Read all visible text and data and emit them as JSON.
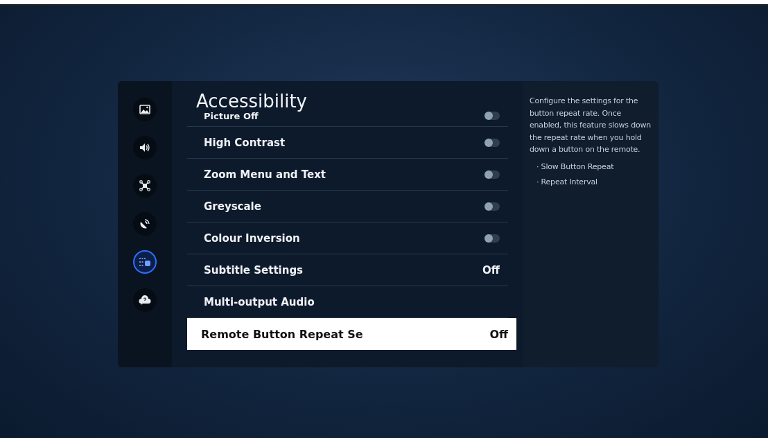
{
  "sidebar": {
    "items": [
      {
        "kind": "picture",
        "selected": false
      },
      {
        "kind": "sound",
        "selected": false
      },
      {
        "kind": "connection",
        "selected": false
      },
      {
        "kind": "broadcast",
        "selected": false
      },
      {
        "kind": "accessibility",
        "selected": true
      },
      {
        "kind": "help",
        "selected": false
      }
    ]
  },
  "title": "Accessibility",
  "rows": [
    {
      "kind": "toggle",
      "label": "Picture Off",
      "on": false,
      "partial": true,
      "selected": false
    },
    {
      "kind": "toggle",
      "label": "High Contrast",
      "on": false,
      "selected": false
    },
    {
      "kind": "toggle",
      "label": "Zoom Menu and Text",
      "on": false,
      "selected": false
    },
    {
      "kind": "toggle",
      "label": "Greyscale",
      "on": false,
      "selected": false
    },
    {
      "kind": "toggle",
      "label": "Colour Inversion",
      "on": false,
      "selected": false
    },
    {
      "kind": "value",
      "label": "Subtitle Settings",
      "value": "Off",
      "selected": false
    },
    {
      "kind": "plain",
      "label": "Multi-output Audio",
      "selected": false
    },
    {
      "kind": "value",
      "label": "Remote Button Repeat Se",
      "value": "Off",
      "selected": true
    }
  ],
  "description": {
    "text": "Configure the settings for the button repeat rate. Once enabled, this feature slows down the repeat rate when you hold down a button on the remote.",
    "bullets": [
      "· Slow Button Repeat",
      "· Repeat Interval"
    ]
  }
}
